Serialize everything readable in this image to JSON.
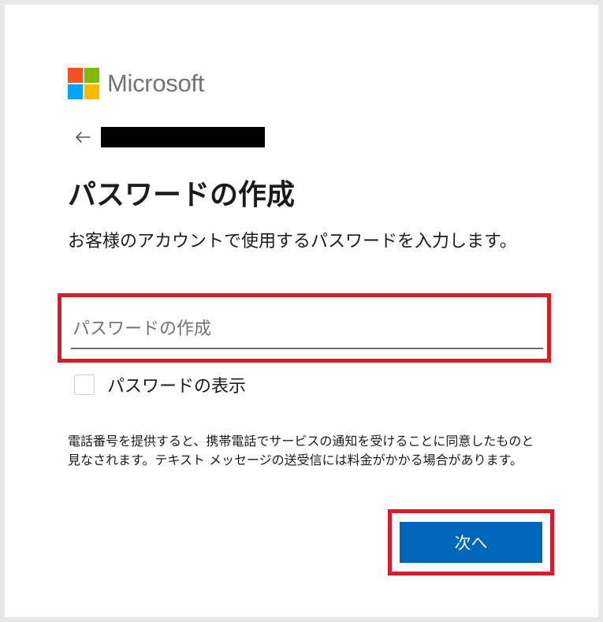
{
  "brand": {
    "name": "Microsoft",
    "logo_colors": [
      "#f25022",
      "#7fba00",
      "#00a4ef",
      "#ffb900"
    ]
  },
  "back": {
    "icon": "arrow-left-icon"
  },
  "title": "パスワードの作成",
  "description": "お客様のアカウントで使用するパスワードを入力します。",
  "password": {
    "placeholder": "パスワードの作成",
    "value": ""
  },
  "show_password": {
    "label": "パスワードの表示",
    "checked": false
  },
  "notice": "電話番号を提供すると、携帯電話でサービスの通知を受けることに同意したものと見なされます。テキスト メッセージの送受信には料金がかかる場合があります。",
  "next_button": {
    "label": "次へ"
  },
  "colors": {
    "primary": "#0067b8",
    "highlight": "#d61b2b"
  }
}
